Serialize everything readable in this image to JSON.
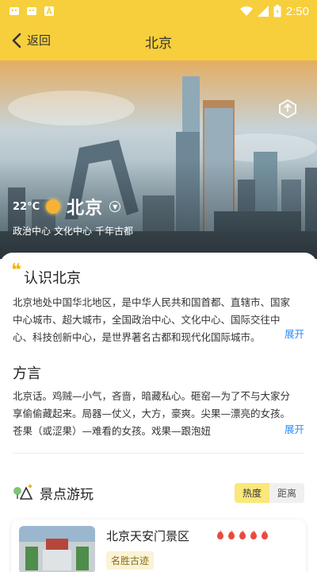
{
  "status_bar": {
    "time": "2:50"
  },
  "header": {
    "back_label": "返回",
    "title": "北京"
  },
  "hero": {
    "temperature": "22°C",
    "city": "北京",
    "tags": [
      "政治中心",
      "文化中心",
      "千年古都"
    ]
  },
  "intro": {
    "title": "认识北京",
    "text": "北京地处中国华北地区，是中华人民共和国首都、直辖市、国家中心城市、超大城市，全国政治中心、文化中心、国际交往中心、科技创新中心，是世界著名古都和现代化国际城市。",
    "expand_label": "展开"
  },
  "dialect": {
    "title": "方言",
    "text": "北京话。鸡贼—小气，吝啬，暗藏私心。砸窑—为了不与大家分享偷偷藏起来。局器—仗义，大方，豪爽。尖果—漂亮的女孩。苍果（或涩果）—难看的女孩。戏果—跟泡妞",
    "expand_label": "展开"
  },
  "spots": {
    "title": "景点游玩",
    "sort_options": [
      "热度",
      "距离"
    ],
    "active_sort": "热度",
    "items": [
      {
        "name": "北京天安门景区",
        "heat": 5,
        "tag": "名胜古迹"
      }
    ]
  },
  "colors": {
    "accent": "#f7cf3c",
    "link": "#2b8cff",
    "flame": "#e94b3c"
  }
}
